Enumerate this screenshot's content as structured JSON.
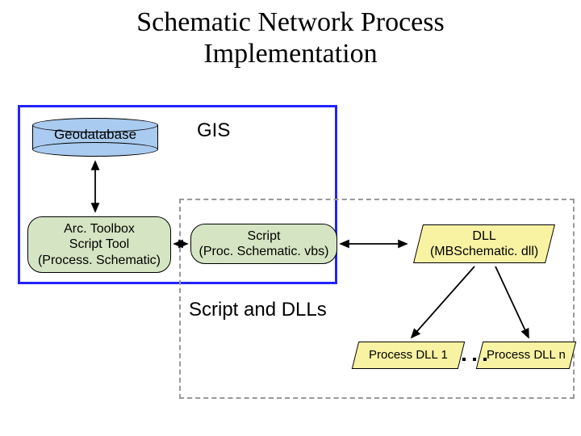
{
  "title_line1": "Schematic Network Process",
  "title_line2": "Implementation",
  "gis_label": "GIS",
  "sd_label": "Script and DLLs",
  "geodatabase": {
    "label": "Geodatabase"
  },
  "arctoolbox": {
    "line1": "Arc. Toolbox",
    "line2": "Script Tool",
    "line3": "(Process. Schematic)"
  },
  "script_node": {
    "line1": "Script",
    "line2": "(Proc. Schematic. vbs)"
  },
  "dll_node": {
    "line1": "DLL",
    "line2": "(MBSchematic. dll)"
  },
  "process_dll_1": "Process DLL 1",
  "process_dll_n": "Process DLL n",
  "ellipsis": "..."
}
